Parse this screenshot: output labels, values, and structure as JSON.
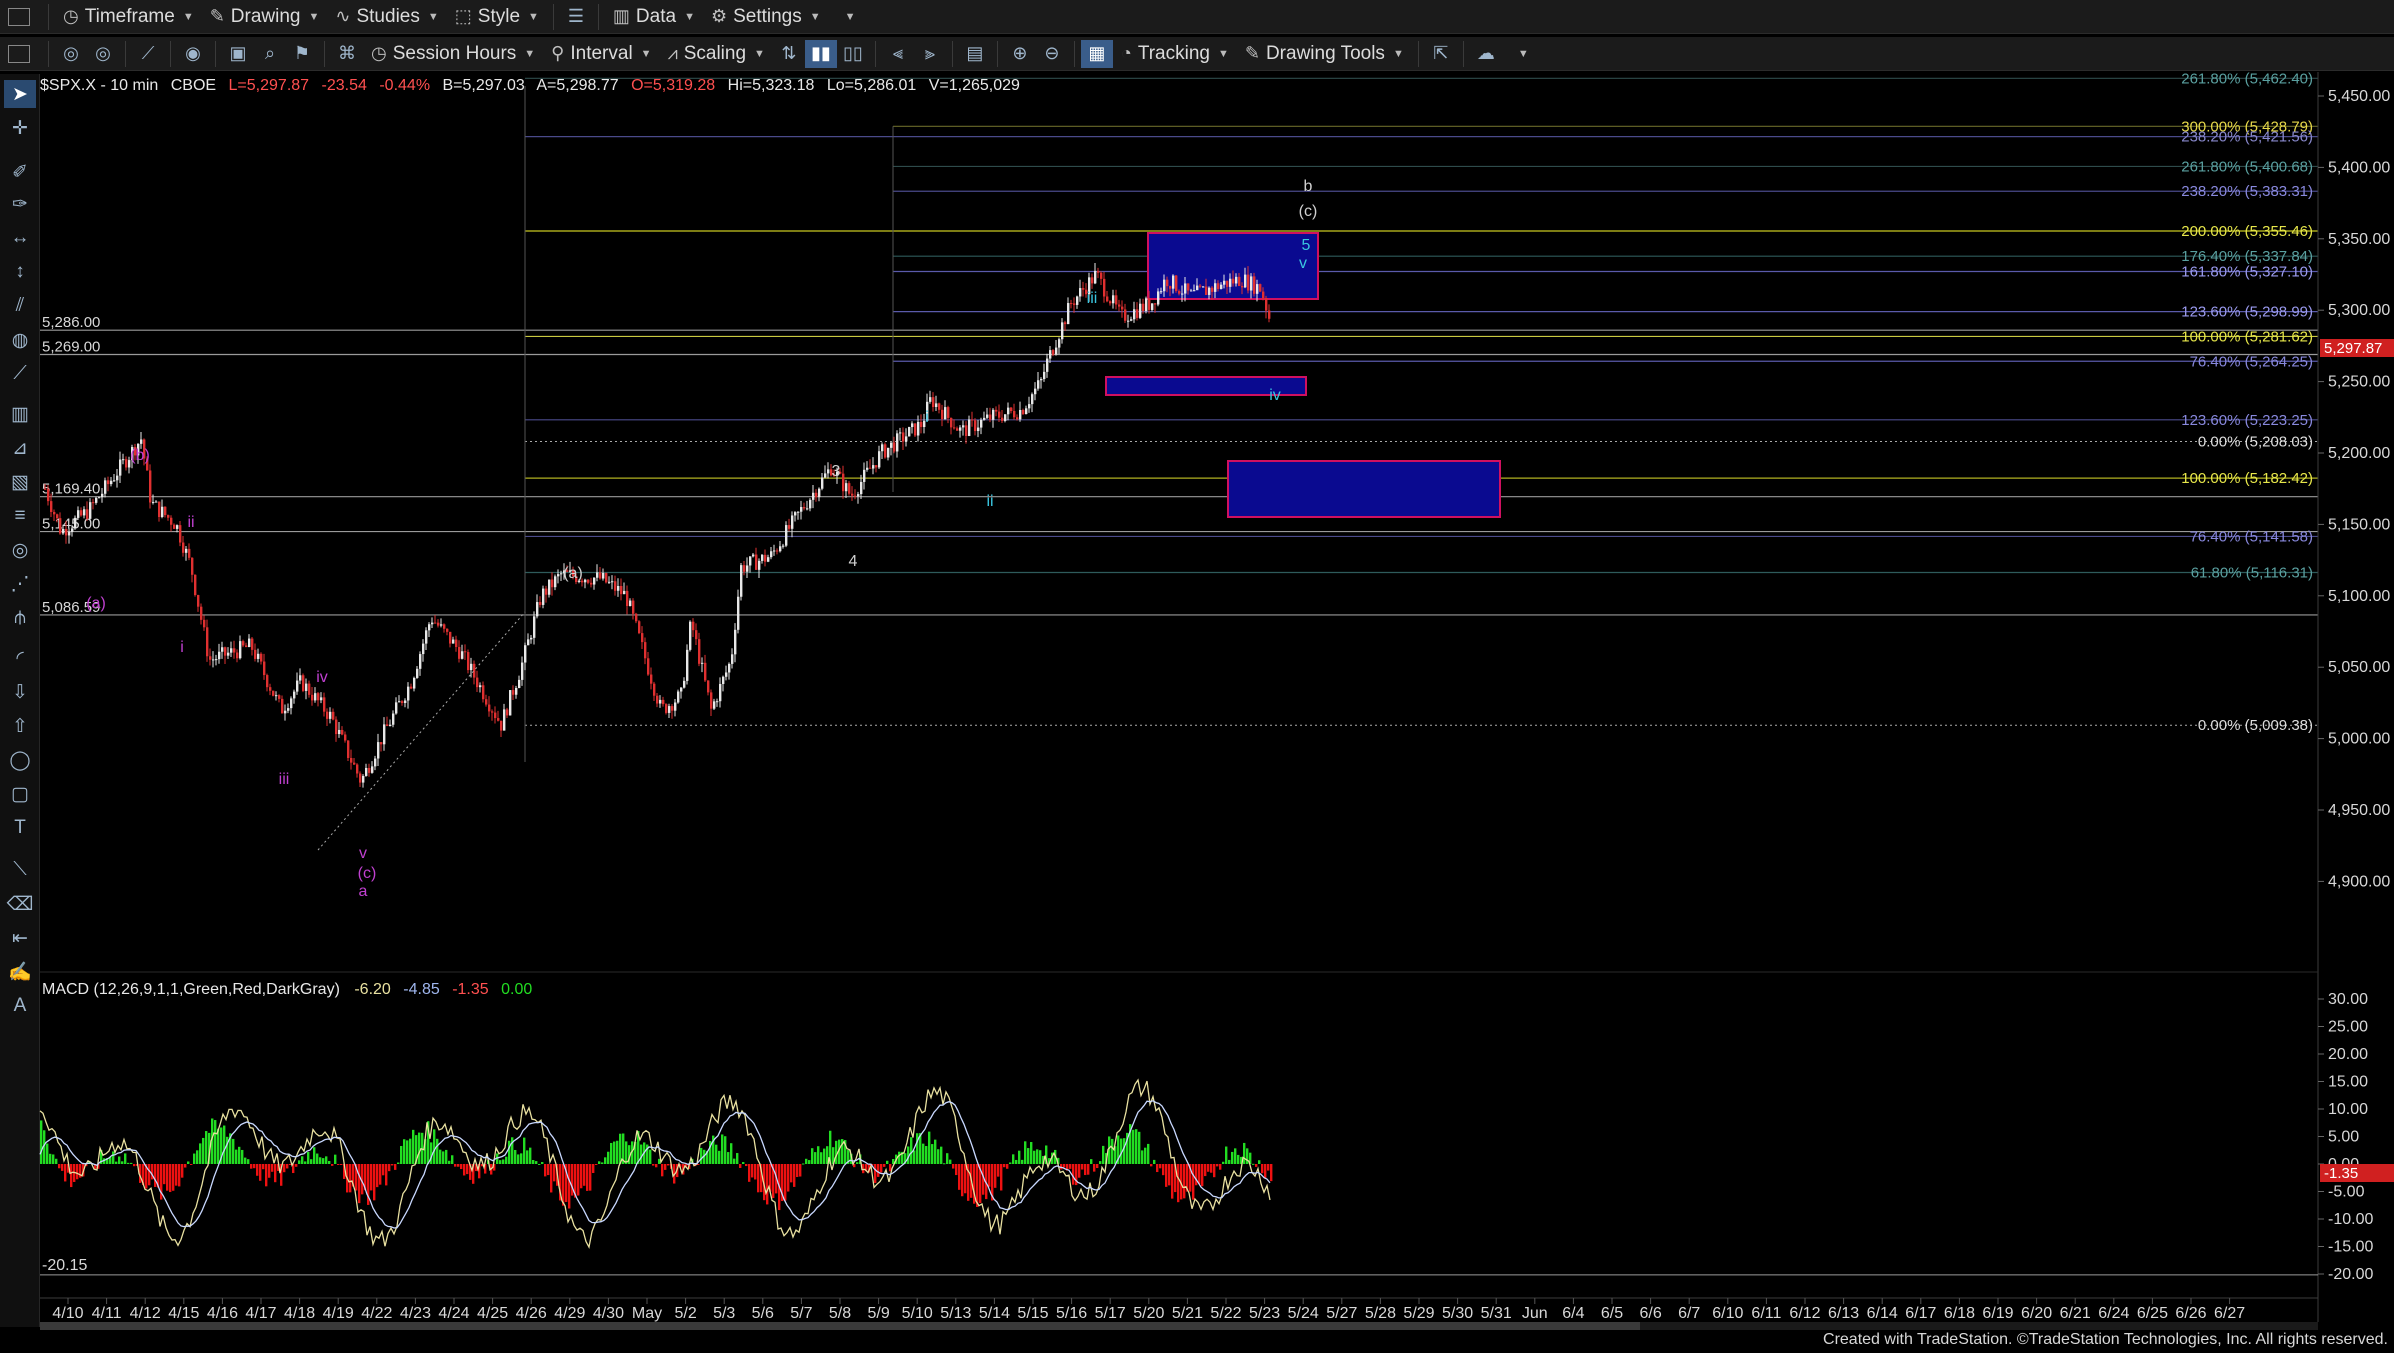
{
  "toolbar1": {
    "timeframe": "Timeframe",
    "drawing": "Drawing",
    "studies": "Studies",
    "style": "Style",
    "data": "Data",
    "settings": "Settings"
  },
  "toolbar2": {
    "session_hours": "Session Hours",
    "interval": "Interval",
    "scaling": "Scaling",
    "tracking": "Tracking",
    "drawing_tools": "Drawing Tools"
  },
  "status": {
    "symbol": "$SPX.X - 10 min",
    "exchange": "CBOE",
    "last": "L=5,297.87",
    "change": "-23.54",
    "change_pct": "-0.44%",
    "bid": "B=5,297.03",
    "ask": "A=5,298.77",
    "open": "O=5,319.28",
    "high": "Hi=5,323.18",
    "low": "Lo=5,286.01",
    "volume": "V=1,265,029"
  },
  "price_axis": [
    "5,450.00",
    "5,400.00",
    "5,350.00",
    "5,300.00",
    "5,250.00",
    "5,200.00",
    "5,150.00",
    "5,100.00",
    "5,050.00",
    "5,000.00",
    "4,950.00",
    "4,900.00"
  ],
  "last_price_tag": "5,297.87",
  "date_axis": [
    "4/10",
    "4/11",
    "4/12",
    "4/15",
    "4/16",
    "4/17",
    "4/18",
    "4/19",
    "4/22",
    "4/23",
    "4/24",
    "4/25",
    "4/26",
    "4/29",
    "4/30",
    "May",
    "5/2",
    "5/3",
    "5/6",
    "5/7",
    "5/8",
    "5/9",
    "5/10",
    "5/13",
    "5/14",
    "5/15",
    "5/16",
    "5/17",
    "5/20",
    "5/21",
    "5/22",
    "5/23",
    "5/24",
    "5/27",
    "5/28",
    "5/29",
    "5/30",
    "5/31",
    "Jun",
    "6/4",
    "6/5",
    "6/6",
    "6/7",
    "6/10",
    "6/11",
    "6/12",
    "6/13",
    "6/14",
    "6/17",
    "6/18",
    "6/19",
    "6/20",
    "6/21",
    "6/24",
    "6/25",
    "6/26",
    "6/27"
  ],
  "left_levels": [
    "5,286.00",
    "5,269.00",
    "5,169.40",
    "5,145.00",
    "5,086.59"
  ],
  "fib_labels": [
    {
      "text": "261.80% (5,462.40)",
      "color": "#5aa0a0"
    },
    {
      "text": "300.00% (5,428.79)",
      "color": "#e6d84a"
    },
    {
      "text": "238.20% (5,421.56)",
      "color": "#8888cc"
    },
    {
      "text": "261.80% (5,400.68)",
      "color": "#5aa0a0"
    },
    {
      "text": "238.20% (5,383.31)",
      "color": "#8888dd"
    },
    {
      "text": "200.00% (5,355.46)",
      "color": "#e6e64a"
    },
    {
      "text": "176.40% (5,337.84)",
      "color": "#5aa0a0"
    },
    {
      "text": "161.80% (5,327.10)",
      "color": "#9a9aee"
    },
    {
      "text": "123.60% (5,298.99)",
      "color": "#9a9aee"
    },
    {
      "text": "100.00% (5,281.62)",
      "color": "#e6e64a"
    },
    {
      "text": "76.40% (5,264.25)",
      "color": "#8888dd"
    },
    {
      "text": "123.60% (5,223.25)",
      "color": "#8888dd"
    },
    {
      "text": "0.00% (5,208.03)",
      "color": "#dddddd"
    },
    {
      "text": "100.00% (5,182.42)",
      "color": "#e6e64a"
    },
    {
      "text": "76.40% (5,141.58)",
      "color": "#8888dd"
    },
    {
      "text": "61.80% (5,116.31)",
      "color": "#5aa0a0"
    },
    {
      "text": "0.00% (5,009.38)",
      "color": "#dddddd"
    }
  ],
  "wave_labels": {
    "purple": [
      "(b)",
      "ii",
      "(a)",
      "i",
      "iv",
      "iii",
      "v",
      "(c)",
      "a"
    ],
    "gray": [
      "(a)",
      "3",
      "4",
      "b",
      "(c)"
    ],
    "cyan": [
      "i",
      "ii",
      "iii",
      "5",
      "v",
      "iv"
    ]
  },
  "macd": {
    "title": "MACD (12,26,9,1,1,Green,Red,DarkGray)",
    "v1": "-6.20",
    "v2": "-4.85",
    "v3": "-1.35",
    "v4": "0.00",
    "axis": [
      "30.00",
      "25.00",
      "20.00",
      "15.00",
      "10.00",
      "5.00",
      "0.00",
      "-5.00",
      "-10.00",
      "-15.00",
      "-20.00"
    ],
    "left_value": "-20.15",
    "last_tag": "-1.35"
  },
  "footer": "Created with TradeStation. ©TradeStation Technologies, Inc. All rights reserved.",
  "colors": {
    "up": "#e8e8e8",
    "down": "#e03030",
    "macd_green": "#22dd22",
    "macd_red": "#ee1111",
    "macd_line": "#e8e0a0",
    "signal_line": "#c8d8ff",
    "box_fill": "#0a0a90",
    "box_border": "#d01060",
    "purple": "#c040d0",
    "cyan": "#3ac6e0",
    "gray": "#d0d0d0"
  },
  "icons": [
    "timeframe-icon",
    "drawing-icon",
    "studies-icon",
    "style-icon",
    "data-icon",
    "settings-icon",
    "session-icon",
    "interval-icon",
    "scaling-icon",
    "zoom-in-icon",
    "zoom-out-icon",
    "tracking-icon",
    "drawing-tools-icon"
  ]
}
